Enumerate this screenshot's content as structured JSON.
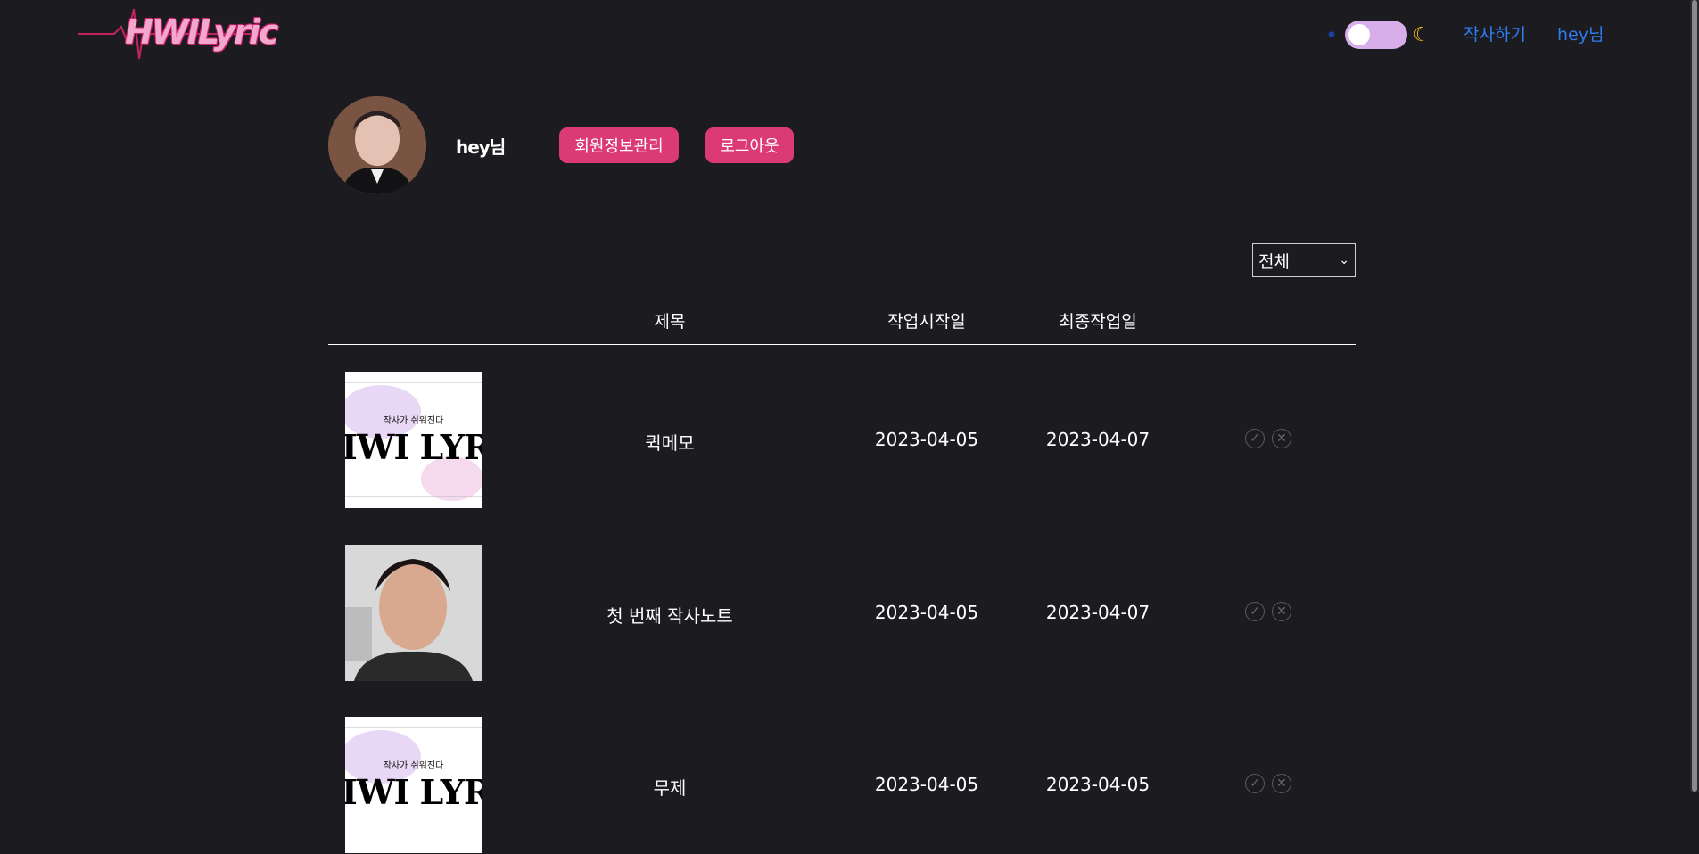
{
  "header": {
    "logo_text": "HWILyric",
    "nav_write": "작사하기",
    "nav_user": "hey님"
  },
  "profile": {
    "name": "hey님",
    "manage_button": "회원정보관리",
    "logout_button": "로그아웃"
  },
  "filter": {
    "selected": "전체"
  },
  "table": {
    "headers": {
      "title": "제목",
      "start": "작업시작일",
      "last": "최종작업일"
    },
    "rows": [
      {
        "title": "퀵메모",
        "start": "2023-04-05",
        "last": "2023-04-07",
        "thumb_small": "작사가 쉬워진다",
        "thumb_big": "IWI LYRI"
      },
      {
        "title": "첫 번째 작사노트",
        "start": "2023-04-05",
        "last": "2023-04-07"
      },
      {
        "title": "무제",
        "start": "2023-04-05",
        "last": "2023-04-05",
        "thumb_small": "작사가 쉬워진다",
        "thumb_big": "IWI LYRI"
      }
    ]
  },
  "colors": {
    "accent": "#dc3a74",
    "link": "#2f7bf0",
    "background": "#1c1c20",
    "toggle": "#d7aee9",
    "moon": "#f4c21b"
  },
  "icons": {
    "theme_light": "sun-icon",
    "theme_dark": "moon-icon",
    "edit": "edit-icon",
    "delete": "close-icon",
    "dropdown": "chevron-down-icon"
  }
}
